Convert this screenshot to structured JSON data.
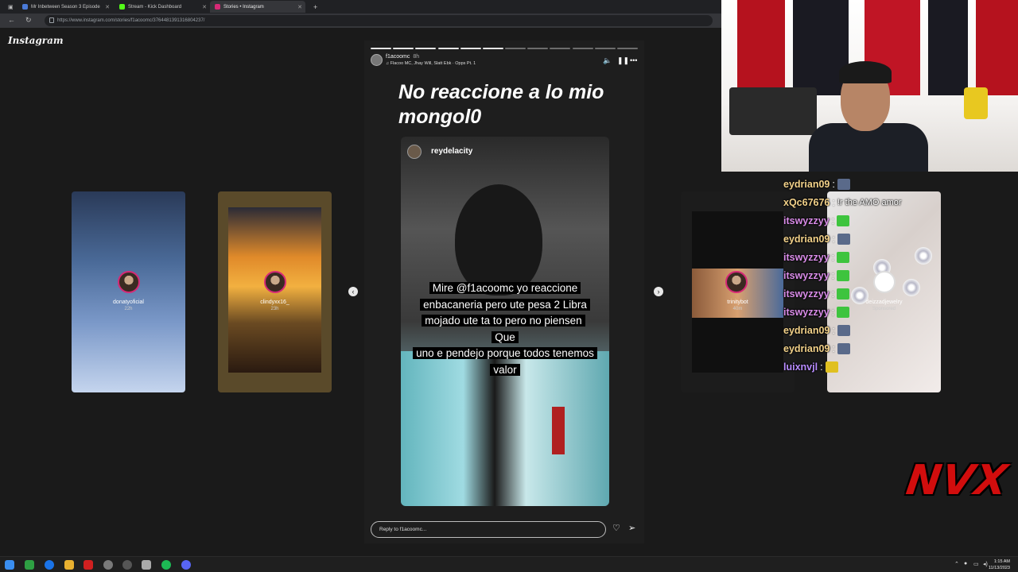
{
  "browser": {
    "tabs": [
      {
        "label": "Mr Inbetween Season 3 Episode",
        "active": false,
        "favicon_color": "#4a7ad8"
      },
      {
        "label": "Stream - Kick Dashboard",
        "active": false,
        "favicon_color": "#53fc18"
      },
      {
        "label": "Stories • Instagram",
        "active": true,
        "favicon_color": "#d62976"
      }
    ],
    "new_tab": "+",
    "url": "https://www.instagram.com/stories/f1acoomc/3764481391316804237/"
  },
  "instagram": {
    "logo": "Instagram",
    "side_stories": [
      {
        "username": "donatyoficial",
        "ago": "22h"
      },
      {
        "username": "clindyxx16_",
        "ago": "23h"
      },
      {
        "username": "trinitybot",
        "ago": "40m"
      },
      {
        "username": "deizzadjewelry",
        "ago": "Sponsored"
      }
    ],
    "story": {
      "username": "f1acoomc",
      "time_ago": "8h",
      "music": "Flacoo MC, Jhay Will, Slatt Ebk · Opps Pt. 1",
      "title": "No reaccione a lo mio mongol0",
      "progress_total": 12,
      "progress_done": 6,
      "embedded_username": "reydelacity",
      "caption_lines": [
        "Mire @f1acoomc yo reaccione",
        "enbacaneria pero ute pesa 2 Libra",
        "mojado ute ta to pero no piensen Que",
        "uno e pendejo porque todos tenemos",
        "valor"
      ],
      "reply_placeholder": "Reply to f1acoomc..."
    }
  },
  "chat": [
    {
      "user": "eydrian09",
      "color": "#f3d28a",
      "message": "",
      "emote": "#5a6a8a"
    },
    {
      "user": "xQc67676",
      "color": "#f3d28a",
      "message": "!r the AMO amor",
      "emote": ""
    },
    {
      "user": "itswyzzyy",
      "color": "#d98ce8",
      "message": "",
      "emote": "#3ec43e"
    },
    {
      "user": "eydrian09",
      "color": "#f3d28a",
      "message": "",
      "emote": "#5a6a8a"
    },
    {
      "user": "itswyzzyy",
      "color": "#d98ce8",
      "message": "",
      "emote": "#3ec43e"
    },
    {
      "user": "itswyzzyy",
      "color": "#d98ce8",
      "message": "",
      "emote": "#3ec43e"
    },
    {
      "user": "itswyzzyy",
      "color": "#d98ce8",
      "message": "",
      "emote": "#3ec43e"
    },
    {
      "user": "itswyzzyy",
      "color": "#d98ce8",
      "message": "",
      "emote": "#3ec43e"
    },
    {
      "user": "eydrian09",
      "color": "#f3d28a",
      "message": "",
      "emote": "#5a6a8a"
    },
    {
      "user": "eydrian09",
      "color": "#f3d28a",
      "message": "",
      "emote": "#5a6a8a"
    },
    {
      "user": "luixnvjl",
      "color": "#b88cff",
      "message": "",
      "emote": "#e0c020"
    }
  ],
  "overlay_logo": "NVX",
  "taskbar": {
    "time": "1:15 AM",
    "date": "11/13/2023"
  }
}
